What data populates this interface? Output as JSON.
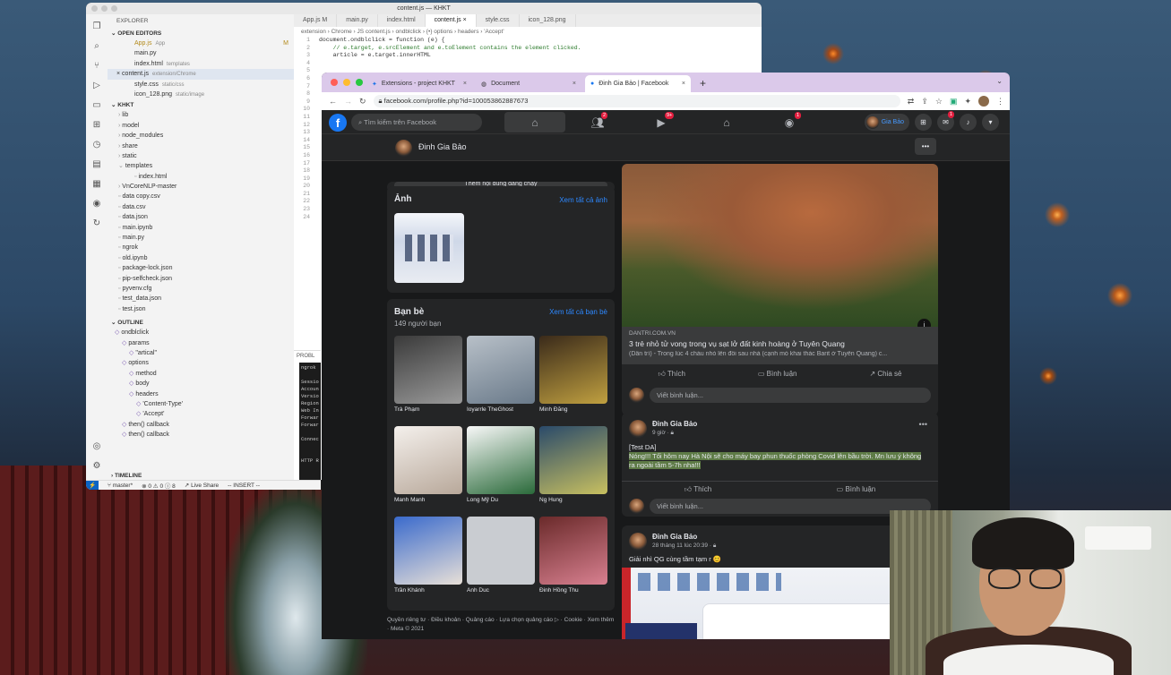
{
  "vscode": {
    "title": "content.js — KHKT",
    "explorer_label": "EXPLORER",
    "open_editors_label": "OPEN EDITORS",
    "open_editors": [
      {
        "name": "App.js",
        "dir": "App",
        "mark": "M"
      },
      {
        "name": "main.py",
        "dir": ""
      },
      {
        "name": "index.html",
        "dir": "templates"
      },
      {
        "name": "content.js",
        "dir": "extension/Chrome"
      },
      {
        "name": "style.css",
        "dir": "static/css"
      },
      {
        "name": "icon_128.png",
        "dir": "static/image"
      }
    ],
    "workspace_label": "KHKT",
    "tree": [
      "lib",
      "model",
      "node_modules",
      "share",
      "static",
      "templates",
      "index.html",
      "VnCoreNLP-master",
      "data copy.csv",
      "data.csv",
      "data.json",
      "main.ipynb",
      "main.py",
      "ngrok",
      "old.ipynb",
      "package-lock.json",
      "pip-selfcheck.json",
      "pyvenv.cfg",
      "test_data.json",
      "test.json"
    ],
    "outline_label": "OUTLINE",
    "outline": [
      "ondblclick",
      "params",
      "\"artical\"",
      "options",
      "method",
      "body",
      "headers",
      "'Content-Type'",
      "'Accept'",
      "then() callback",
      "then() callback"
    ],
    "timeline_label": "TIMELINE",
    "tabs": [
      "App.js M",
      "main.py",
      "index.html",
      "content.js ×",
      "style.css",
      "icon_128.png"
    ],
    "breadcrumb": "extension › Chrome › JS content.js › ondblclick › {•} options › headers › 'Accept'",
    "line_numbers": [
      "1",
      "2",
      "3",
      "4",
      "5",
      "6",
      "7",
      "8",
      "9",
      "10",
      "11",
      "12",
      "13",
      "14",
      "15",
      "16",
      "17",
      "18",
      "19",
      "20",
      "21",
      "22",
      "23",
      "24"
    ],
    "code": [
      "document.ondblclick = function (e) {",
      "    // e.target, e.srcElement and e.toElement contains the element clicked.",
      "    article = e.target.innerHTML"
    ],
    "problems_label": "PROBL",
    "terminal": [
      "ngrok",
      "",
      "Sessio",
      "Accoun",
      "Versio",
      "Region",
      "Web In",
      "Forwar",
      "Forwar",
      "",
      "Connec",
      "",
      "",
      "HTTP R",
      "",
      "",
      "GET  /",
      "GET  /"
    ],
    "status": {
      "branch": "master*",
      "errors": "0 ⚠ 0 ⓘ 8",
      "live_share": "Live Share",
      "mode": "-- INSERT --"
    }
  },
  "chrome": {
    "tabs": [
      {
        "label": "Extensions - project KHKT"
      },
      {
        "label": "Document"
      },
      {
        "label": "Đinh Gia Bảo | Facebook",
        "active": true
      }
    ],
    "url": "facebook.com/profile.php?id=100053862887673"
  },
  "facebook": {
    "search_placeholder": "Tìm kiếm trên Facebook",
    "nav_badges": {
      "friends": "2",
      "watch": "9+",
      "groups": "1",
      "messenger": "1"
    },
    "profile_name_short": "Gia Bảo",
    "profile_name": "Đinh Gia Bảo",
    "hidden_btn": "Thêm nội dung đang chạy",
    "photos": {
      "title": "Ảnh",
      "see_all": "Xem tất cả ảnh"
    },
    "friends": {
      "title": "Bạn bè",
      "count": "149 người bạn",
      "see_all": "Xem tất cả bạn bè",
      "items": [
        "Trà Phạm",
        "Ioyarrle TheGhost",
        "Minh Đăng",
        "Manh Manh",
        "Long Mỹ Du",
        "Ng Hung",
        "Trần Khánh",
        "Anh Duc",
        "Đinh Hồng Thu"
      ]
    },
    "footer": "Quyền riêng tư · Điều khoản · Quảng cáo · Lựa chọn quảng cáo ▷ · Cookie · Xem thêm · Meta © 2021",
    "post1": {
      "source": "DANTRI.COM.VN",
      "headline": "3 trẻ nhỏ tử vong trong vụ sạt lở đất kinh hoàng ở Tuyên Quang",
      "snippet": "(Dân trí) - Trong lúc 4 cháu nhỏ lên đồi sau nhà (cạnh mỏ khai thác Barit ở Tuyên Quang) c..."
    },
    "actions": {
      "like": "Thích",
      "comment": "Bình luận",
      "share": "Chia sẻ"
    },
    "comment_placeholder": "Viết bình luận...",
    "post2": {
      "author": "Đinh Gia Bảo",
      "time": "9 giờ",
      "tag": "[Test DA]",
      "body": "Nóng!!! Tối hôm nay Hà Nội sẽ cho máy bay phun thuốc phòng Covid lên bầu trời. Mn lưu ý không ra ngoài tầm 5-7h nha!!!"
    },
    "post3": {
      "author": "Đinh Gia Bảo",
      "time": "28 tháng 11 lúc 20:39",
      "body": "Giải nhì QG cùng tầm tạm r 😊"
    }
  }
}
